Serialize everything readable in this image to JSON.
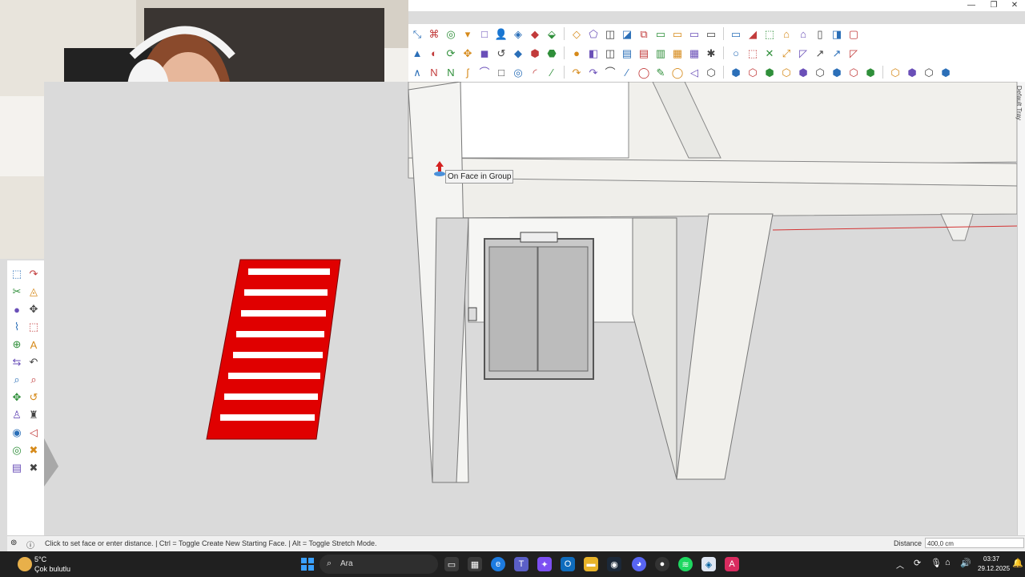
{
  "window": {
    "minimize": "—",
    "maximize": "❐",
    "close": "✕"
  },
  "toolbar1": [
    "⤡",
    "⌘",
    "◎",
    "▾",
    "□",
    "👤",
    "◈",
    "◆",
    "⬙",
    "◇",
    "⬠",
    "◫",
    "◪",
    "⧉",
    "▭",
    "▭",
    "▭",
    "▭",
    "▭",
    "◢",
    "⬚",
    "⌂",
    "⌂",
    "▯",
    "◨",
    "▢"
  ],
  "toolbar2": [
    "▲",
    "◐",
    "⟳",
    "✥",
    "◼",
    "↺",
    "◆",
    "⬢",
    "⬣",
    "●",
    "◧",
    "◫",
    "▤",
    "▤",
    "▥",
    "▦",
    "▦",
    "✱",
    "○",
    "⬚",
    "✕",
    "⤢",
    "◸",
    "↗",
    "↗",
    "◸"
  ],
  "toolbar3": [
    "∧",
    "Ν",
    "Ν",
    "ʃ",
    "⌒",
    "□",
    "◎",
    "◜",
    "∕",
    "↷",
    "↷",
    "⌒",
    "∕",
    "◯",
    "✎",
    "◯",
    "◁",
    "⬡",
    "⬢",
    "⬡",
    "⬢",
    "⬡",
    "⬢",
    "⬡",
    "⬢",
    "⬡",
    "⬢",
    "⬡",
    "⬢",
    "⬡",
    "⬢"
  ],
  "left_tools": [
    "⬚",
    "↷",
    "✂",
    "◬",
    "●",
    "✥",
    "⌇",
    "⬚",
    "⊕",
    "A",
    "⇆",
    "↶",
    "⌕",
    "⌕",
    "✥",
    "↺",
    "♙",
    "♜",
    "◉",
    "◁",
    "◎",
    "✖",
    "▤",
    "✖"
  ],
  "tooltip": "On Face in Group",
  "default_tray": "Default Tray",
  "status": {
    "message": "Click to set face or enter distance. | Ctrl = Toggle Create New Starting Face. | Alt = Toggle Stretch Mode.",
    "distance_label": "Distance",
    "distance_value": "400,0 cm"
  },
  "taskbar": {
    "weather_temp": "5°C",
    "weather_desc": "Çok bulutlu",
    "search_placeholder": "Ara",
    "time": "03:37",
    "date": "29.12.2025"
  },
  "colors": {
    "stair": "#e00000",
    "sketchup_bg": "#dadada",
    "taskbar": "#202020"
  }
}
